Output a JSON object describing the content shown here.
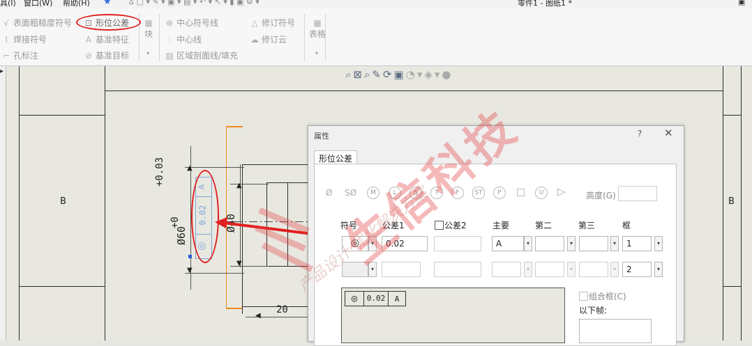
{
  "menu": {
    "item1": "具(I)",
    "item2": "窗口(W)",
    "item3": "帮助(H)"
  },
  "doc_title": "零件1 - 图纸1 *",
  "ribbon": {
    "surface_finish": "表面粗糙度符号",
    "weld_symbol": "焊接符号",
    "hole_callout": "孔标注",
    "gtol": "形位公差",
    "datum_feature": "基准特征",
    "datum_target": "基准目标",
    "block": "块",
    "center_mark": "中心符号线",
    "centerline": "中心线",
    "area_hatch": "区域剖面线/填充",
    "revision_symbol": "修订符号",
    "revision_cloud": "修订云",
    "table": "表格"
  },
  "drawing": {
    "zone_left": "B",
    "zone_right": "B",
    "tol_upper": "+0.03",
    "tol_lower": "+0",
    "dia_60": "Ø60",
    "dia_40": "Ø40",
    "dim_20": "20",
    "frame_value": "0.02",
    "frame_datum": "A"
  },
  "dialog": {
    "title": "属性",
    "help": "?",
    "close": "✕",
    "tab": "形位公差",
    "height_label": "高度(G)",
    "col_symbol": "符号",
    "col_tol1": "公差1",
    "col_tol2": "公差2",
    "col_primary": "主要",
    "col_second": "第二",
    "col_third": "第三",
    "col_frame": "框",
    "tol1_value": "0.02",
    "primary_value": "A",
    "frame1_value": "1",
    "frame2_value": "2",
    "composite_label": "组合框(C)",
    "below_label": "以下帧:",
    "preview_value": "0.02",
    "preview_datum": "A",
    "modifier_symbols": [
      "Ø",
      "SØ",
      "M",
      "L",
      "S",
      "T",
      "F",
      "ST",
      "P",
      "□",
      "U",
      "▷"
    ]
  },
  "watermark": {
    "big": "生信科技",
    "small": "产品设计·优化解决方案"
  }
}
